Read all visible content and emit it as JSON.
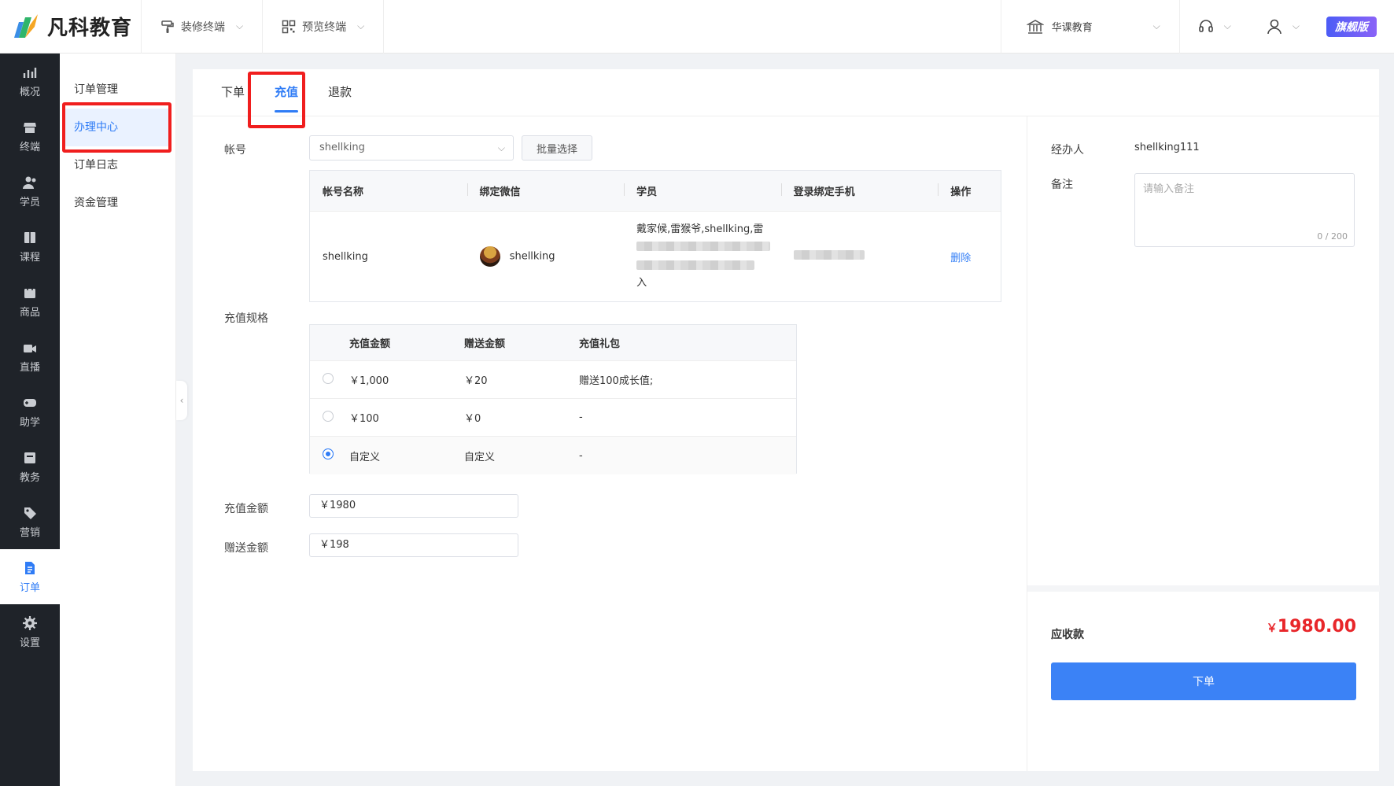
{
  "brand": {
    "name": "凡科教育"
  },
  "topbar": {
    "tools": [
      {
        "label": "装修终端",
        "icon": "paint-roller-icon"
      },
      {
        "label": "预览终端",
        "icon": "qrcode-icon"
      }
    ],
    "org_name": "华课教育",
    "edition_badge": "旗舰版"
  },
  "leftnav": [
    {
      "label": "概况",
      "icon": "chart-icon"
    },
    {
      "label": "终端",
      "icon": "store-icon"
    },
    {
      "label": "学员",
      "icon": "students-icon"
    },
    {
      "label": "课程",
      "icon": "book-icon"
    },
    {
      "label": "商品",
      "icon": "bag-icon"
    },
    {
      "label": "直播",
      "icon": "video-icon"
    },
    {
      "label": "助学",
      "icon": "gamepad-icon"
    },
    {
      "label": "教务",
      "icon": "calendar-icon"
    },
    {
      "label": "营销",
      "icon": "tag-icon"
    },
    {
      "label": "订单",
      "icon": "document-icon",
      "active": true
    },
    {
      "label": "设置",
      "icon": "gear-icon"
    }
  ],
  "subnav": [
    {
      "label": "订单管理"
    },
    {
      "label": "办理中心",
      "active": true
    },
    {
      "label": "订单日志"
    },
    {
      "label": "资金管理"
    }
  ],
  "tabs": [
    {
      "label": "下单"
    },
    {
      "label": "充值",
      "active": true
    },
    {
      "label": "退款"
    }
  ],
  "form": {
    "account_label": "帐号",
    "account_value": "shellking",
    "batch_button": "批量选择",
    "account_table": {
      "headers": [
        "帐号名称",
        "绑定微信",
        "学员",
        "登录绑定手机",
        "操作"
      ],
      "row": {
        "name": "shellking",
        "wechat": "shellking",
        "students_line1": "戴家候,雷猴爷,shellking,雷",
        "students_line3": "入",
        "action": "删除"
      }
    },
    "spec_label": "充值规格",
    "spec_table": {
      "headers": [
        "充值金额",
        "赠送金额",
        "充值礼包"
      ],
      "rows": [
        {
          "amount": "￥1,000",
          "gift_amount": "￥20",
          "package": "赠送100成长值;",
          "selected": false
        },
        {
          "amount": "￥100",
          "gift_amount": "￥0",
          "package": "-",
          "selected": false
        },
        {
          "amount": "自定义",
          "gift_amount": "自定义",
          "package": "-",
          "selected": true
        }
      ]
    },
    "recharge_label": "充值金额",
    "recharge_value": "￥1980",
    "gift_label": "赠送金额",
    "gift_value": "￥198"
  },
  "right_panel": {
    "handler_label": "经办人",
    "handler_value": "shellking111",
    "remark_label": "备注",
    "remark_placeholder": "请输入备注",
    "remark_count": "0 / 200",
    "due_label": "应收款",
    "due_currency": "￥",
    "due_amount": "1980.00",
    "submit_button": "下单"
  },
  "colors": {
    "accent": "#2f7cf6",
    "highlight": "#f01e1e",
    "amount": "#e8262a"
  }
}
